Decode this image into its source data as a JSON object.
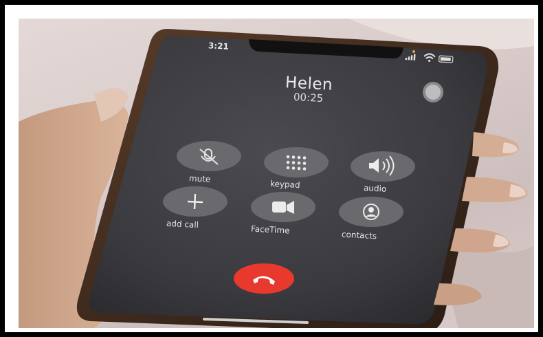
{
  "status_bar": {
    "time": "3:21"
  },
  "call": {
    "name": "Helen",
    "duration": "00:25"
  },
  "buttons": {
    "mute": "mute",
    "keypad": "keypad",
    "audio": "audio",
    "add_call": "add call",
    "facetime": "FaceTime",
    "contacts": "contacts"
  },
  "icons": [
    "mute-icon",
    "keypad-icon",
    "speaker-icon",
    "plus-icon",
    "video-camera-icon",
    "contact-icon",
    "end-call-icon"
  ],
  "colors": {
    "end_call": "#e8392e",
    "screen": "#3a3a3e",
    "button_bg": "#6a6a6e"
  }
}
